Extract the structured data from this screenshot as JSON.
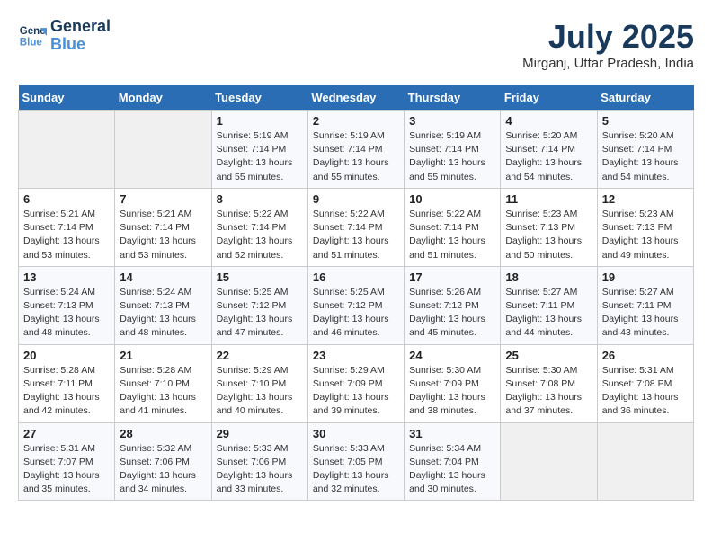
{
  "header": {
    "logo_line1": "General",
    "logo_line2": "Blue",
    "month": "July 2025",
    "location": "Mirganj, Uttar Pradesh, India"
  },
  "weekdays": [
    "Sunday",
    "Monday",
    "Tuesday",
    "Wednesday",
    "Thursday",
    "Friday",
    "Saturday"
  ],
  "weeks": [
    [
      {
        "day": "",
        "detail": ""
      },
      {
        "day": "",
        "detail": ""
      },
      {
        "day": "1",
        "detail": "Sunrise: 5:19 AM\nSunset: 7:14 PM\nDaylight: 13 hours\nand 55 minutes."
      },
      {
        "day": "2",
        "detail": "Sunrise: 5:19 AM\nSunset: 7:14 PM\nDaylight: 13 hours\nand 55 minutes."
      },
      {
        "day": "3",
        "detail": "Sunrise: 5:19 AM\nSunset: 7:14 PM\nDaylight: 13 hours\nand 55 minutes."
      },
      {
        "day": "4",
        "detail": "Sunrise: 5:20 AM\nSunset: 7:14 PM\nDaylight: 13 hours\nand 54 minutes."
      },
      {
        "day": "5",
        "detail": "Sunrise: 5:20 AM\nSunset: 7:14 PM\nDaylight: 13 hours\nand 54 minutes."
      }
    ],
    [
      {
        "day": "6",
        "detail": "Sunrise: 5:21 AM\nSunset: 7:14 PM\nDaylight: 13 hours\nand 53 minutes."
      },
      {
        "day": "7",
        "detail": "Sunrise: 5:21 AM\nSunset: 7:14 PM\nDaylight: 13 hours\nand 53 minutes."
      },
      {
        "day": "8",
        "detail": "Sunrise: 5:22 AM\nSunset: 7:14 PM\nDaylight: 13 hours\nand 52 minutes."
      },
      {
        "day": "9",
        "detail": "Sunrise: 5:22 AM\nSunset: 7:14 PM\nDaylight: 13 hours\nand 51 minutes."
      },
      {
        "day": "10",
        "detail": "Sunrise: 5:22 AM\nSunset: 7:14 PM\nDaylight: 13 hours\nand 51 minutes."
      },
      {
        "day": "11",
        "detail": "Sunrise: 5:23 AM\nSunset: 7:13 PM\nDaylight: 13 hours\nand 50 minutes."
      },
      {
        "day": "12",
        "detail": "Sunrise: 5:23 AM\nSunset: 7:13 PM\nDaylight: 13 hours\nand 49 minutes."
      }
    ],
    [
      {
        "day": "13",
        "detail": "Sunrise: 5:24 AM\nSunset: 7:13 PM\nDaylight: 13 hours\nand 48 minutes."
      },
      {
        "day": "14",
        "detail": "Sunrise: 5:24 AM\nSunset: 7:13 PM\nDaylight: 13 hours\nand 48 minutes."
      },
      {
        "day": "15",
        "detail": "Sunrise: 5:25 AM\nSunset: 7:12 PM\nDaylight: 13 hours\nand 47 minutes."
      },
      {
        "day": "16",
        "detail": "Sunrise: 5:25 AM\nSunset: 7:12 PM\nDaylight: 13 hours\nand 46 minutes."
      },
      {
        "day": "17",
        "detail": "Sunrise: 5:26 AM\nSunset: 7:12 PM\nDaylight: 13 hours\nand 45 minutes."
      },
      {
        "day": "18",
        "detail": "Sunrise: 5:27 AM\nSunset: 7:11 PM\nDaylight: 13 hours\nand 44 minutes."
      },
      {
        "day": "19",
        "detail": "Sunrise: 5:27 AM\nSunset: 7:11 PM\nDaylight: 13 hours\nand 43 minutes."
      }
    ],
    [
      {
        "day": "20",
        "detail": "Sunrise: 5:28 AM\nSunset: 7:11 PM\nDaylight: 13 hours\nand 42 minutes."
      },
      {
        "day": "21",
        "detail": "Sunrise: 5:28 AM\nSunset: 7:10 PM\nDaylight: 13 hours\nand 41 minutes."
      },
      {
        "day": "22",
        "detail": "Sunrise: 5:29 AM\nSunset: 7:10 PM\nDaylight: 13 hours\nand 40 minutes."
      },
      {
        "day": "23",
        "detail": "Sunrise: 5:29 AM\nSunset: 7:09 PM\nDaylight: 13 hours\nand 39 minutes."
      },
      {
        "day": "24",
        "detail": "Sunrise: 5:30 AM\nSunset: 7:09 PM\nDaylight: 13 hours\nand 38 minutes."
      },
      {
        "day": "25",
        "detail": "Sunrise: 5:30 AM\nSunset: 7:08 PM\nDaylight: 13 hours\nand 37 minutes."
      },
      {
        "day": "26",
        "detail": "Sunrise: 5:31 AM\nSunset: 7:08 PM\nDaylight: 13 hours\nand 36 minutes."
      }
    ],
    [
      {
        "day": "27",
        "detail": "Sunrise: 5:31 AM\nSunset: 7:07 PM\nDaylight: 13 hours\nand 35 minutes."
      },
      {
        "day": "28",
        "detail": "Sunrise: 5:32 AM\nSunset: 7:06 PM\nDaylight: 13 hours\nand 34 minutes."
      },
      {
        "day": "29",
        "detail": "Sunrise: 5:33 AM\nSunset: 7:06 PM\nDaylight: 13 hours\nand 33 minutes."
      },
      {
        "day": "30",
        "detail": "Sunrise: 5:33 AM\nSunset: 7:05 PM\nDaylight: 13 hours\nand 32 minutes."
      },
      {
        "day": "31",
        "detail": "Sunrise: 5:34 AM\nSunset: 7:04 PM\nDaylight: 13 hours\nand 30 minutes."
      },
      {
        "day": "",
        "detail": ""
      },
      {
        "day": "",
        "detail": ""
      }
    ]
  ]
}
